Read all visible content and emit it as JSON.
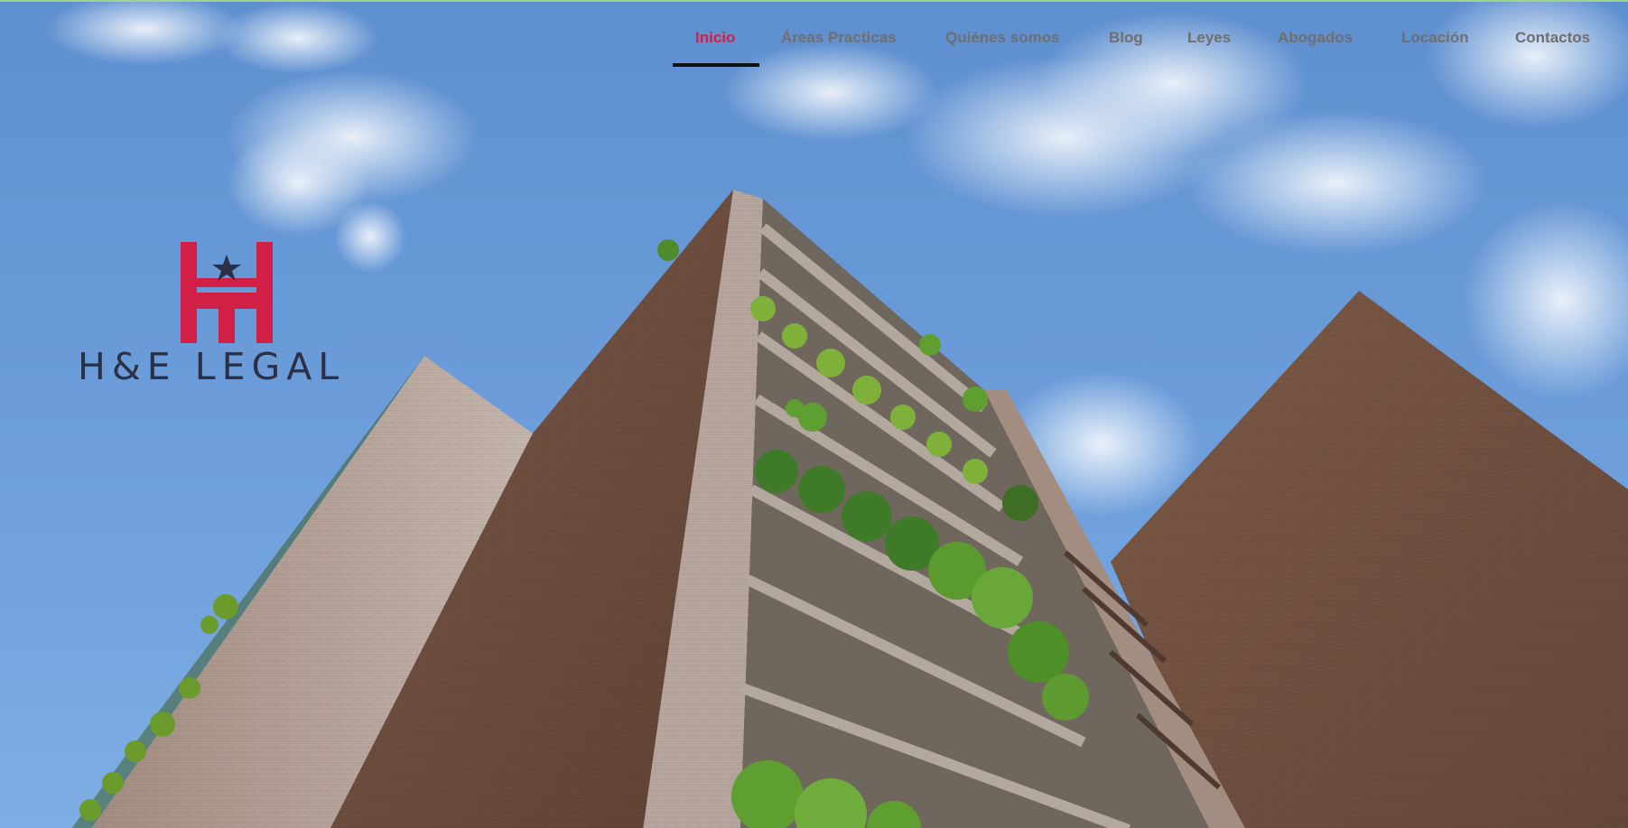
{
  "nav": {
    "items": [
      {
        "label": "Inicio",
        "active": true
      },
      {
        "label": "Áreas Practicas",
        "active": false
      },
      {
        "label": "Quiénes somos",
        "active": false
      },
      {
        "label": "Blog",
        "active": false
      },
      {
        "label": "Leyes",
        "active": false
      },
      {
        "label": "Abogados",
        "active": false
      },
      {
        "label": "Locación",
        "active": false
      },
      {
        "label": "Contactos",
        "active": false
      }
    ]
  },
  "brand": {
    "name": "H&E LEGAL",
    "logo_color": "#d21f45",
    "text_color": "#2b3047"
  },
  "colors": {
    "nav_active": "#d21f45",
    "nav_default": "#6f6f70",
    "sky": "#6d9fd8"
  }
}
